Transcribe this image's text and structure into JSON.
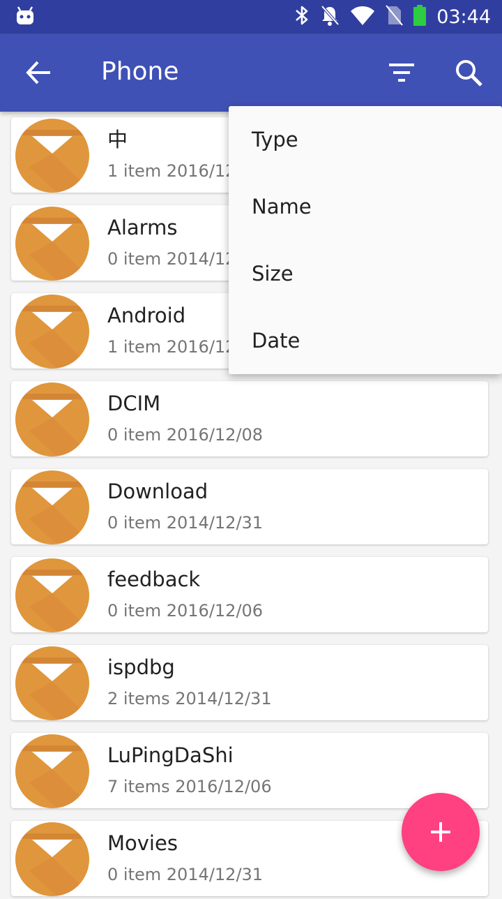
{
  "status_bar": {
    "time": "03:44",
    "icons": [
      "android-icon",
      "bluetooth-icon",
      "notifications-off-icon",
      "wifi-icon",
      "no-sim-icon",
      "battery-icon"
    ],
    "battery_color": "#2ecc40"
  },
  "app_bar": {
    "title": "Phone",
    "back_icon": "arrow-back-icon",
    "filter_icon": "filter-icon",
    "search_icon": "search-icon"
  },
  "sort_menu": {
    "items": [
      "Type",
      "Name",
      "Size",
      "Date"
    ]
  },
  "files": [
    {
      "name": "中",
      "meta": "1 item 2016/12"
    },
    {
      "name": "Alarms",
      "meta": "0 item 2014/12"
    },
    {
      "name": "Android",
      "meta": "1 item 2016/12"
    },
    {
      "name": "DCIM",
      "meta": "0 item 2016/12/08"
    },
    {
      "name": "Download",
      "meta": "0 item 2014/12/31"
    },
    {
      "name": "feedback",
      "meta": "0 item 2016/12/06"
    },
    {
      "name": "ispdbg",
      "meta": "2 items 2014/12/31"
    },
    {
      "name": "LuPingDaShi",
      "meta": "7 items 2016/12/06"
    },
    {
      "name": "Movies",
      "meta": "0 item 2014/12/31"
    }
  ],
  "fab": {
    "icon": "plus-icon"
  },
  "colors": {
    "primary": "#3f51b5",
    "primary_dark": "#303f9f",
    "accent": "#ff4081",
    "folder": "#e0963c"
  }
}
